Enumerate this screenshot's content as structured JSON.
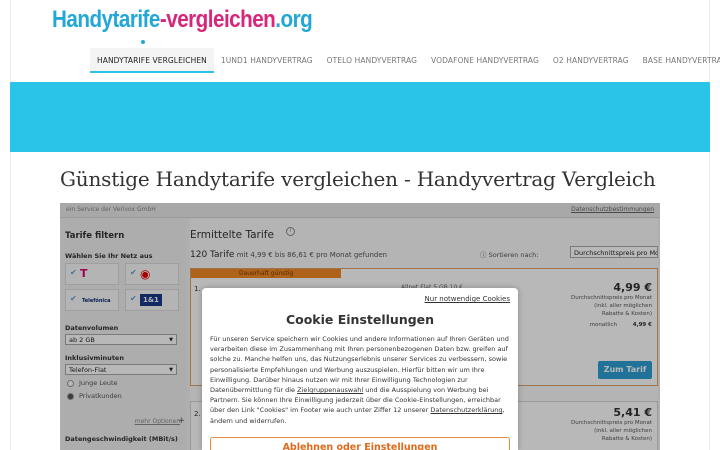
{
  "brand": {
    "logo_part1": "Handytarife",
    "logo_part2": "-vergleichen",
    "logo_part3": ".org"
  },
  "nav": {
    "items": [
      {
        "label": "HANDYTARIFE VERGLEICHEN",
        "active": true
      },
      {
        "label": "1UND1 HANDYVERTRAG"
      },
      {
        "label": "OTELO HANDYVERTRAG"
      },
      {
        "label": "VODAFONE HANDYVERTRAG"
      },
      {
        "label": "O2 HANDYVERTRAG"
      },
      {
        "label": "BASE HANDYVERTRAG"
      }
    ]
  },
  "colors": {
    "accent": "#29c4e8",
    "logo_blue": "#23a7d6",
    "logo_pink": "#d8267a",
    "badge_orange": "#f08a24",
    "button_blue": "#2d9fd5"
  },
  "page": {
    "title": "Günstige Handytarife vergleichen - Handyvertrag Vergleich"
  },
  "widget": {
    "service_by": "ein Service der Verivox GmbH",
    "privacy_link": "Datenschutzbestimmungen",
    "filter": {
      "title": "Tarife filtern",
      "network_label": "Wählen Sie Ihr Netz aus",
      "networks": [
        {
          "name": "T",
          "icon": "telekom-logo"
        },
        {
          "name": "Vodafone",
          "icon": "vodafone-logo"
        },
        {
          "name": "Telefónica",
          "icon": "telefonica-logo"
        },
        {
          "name": "1&1",
          "icon": "1und1-logo"
        }
      ],
      "data_volume_label": "Datenvolumen",
      "data_volume_value": "ab 2 GB",
      "minutes_label": "Inklusivminuten",
      "minutes_value": "Telefon-Flat",
      "customer_options": [
        "Junge Leute",
        "Privatkunden"
      ],
      "more_options": "mehr Optionen",
      "speed_label": "Datengeschwindigkeit (MBit/s)"
    },
    "results": {
      "title": "Ermittelte Tarife",
      "count_number": "120 Tarife",
      "count_rest": "mit 4,99 € bis 86,61 € pro Monat gefunden",
      "sort_label": "Sortieren nach:",
      "sort_value": "Durchschnittspreis pro Monat",
      "cards": [
        {
          "num": "1.",
          "badge": "Dauerhaft günstig",
          "price": "4,99 €",
          "price_note": "Durchschnittspreis pro Monat",
          "price_note2": "(inkl. aller möglichen Rabatte & Kosten)",
          "monthly_label": "monatlich",
          "monthly_value": "4,99 €",
          "feature": "Allnet   Flat   5 GB   10 €",
          "button": "Zum Tarif"
        },
        {
          "num": "2.",
          "price": "5,41 €",
          "price_note": "Durchschnittspreis pro Monat",
          "price_note2": "(inkl. aller möglichen Rabatte & Kosten)"
        }
      ]
    }
  },
  "cookie_modal": {
    "necessary_link": "Nur notwendige Cookies",
    "title": "Cookie Einstellungen",
    "text_1": "Für unseren Service speichern wir Cookies und andere Informationen auf Ihren Geräten und verarbeiten diese im Zusammenhang mit Ihren personenbezogenen Daten bzw. greifen auf solche zu. Manche helfen uns, das Nutzungserlebnis unserer Services zu verbessern, sowie personalisierte Empfehlungen und Werbung auszuspielen. Hierfür bitten wir um Ihre Einwilligung. Darüber hinaus nutzen wir mit Ihrer Einwilligung Technologien zur Datenübermittlung für die ",
    "link_1": "Zielgruppenauswahl",
    "text_2": " und die Ausspielung von Werbung bei Partnern. Sie können Ihre Einwilligung jederzeit über die Cookie-Einstellungen, erreichbar über den Link \"Cookies\" im Footer wie auch unter Ziffer 12 unserer ",
    "link_2": "Datenschutzerklärung",
    "text_3": ", ändern und widerrufen.",
    "button": "Ablehnen oder Einstellungen"
  }
}
